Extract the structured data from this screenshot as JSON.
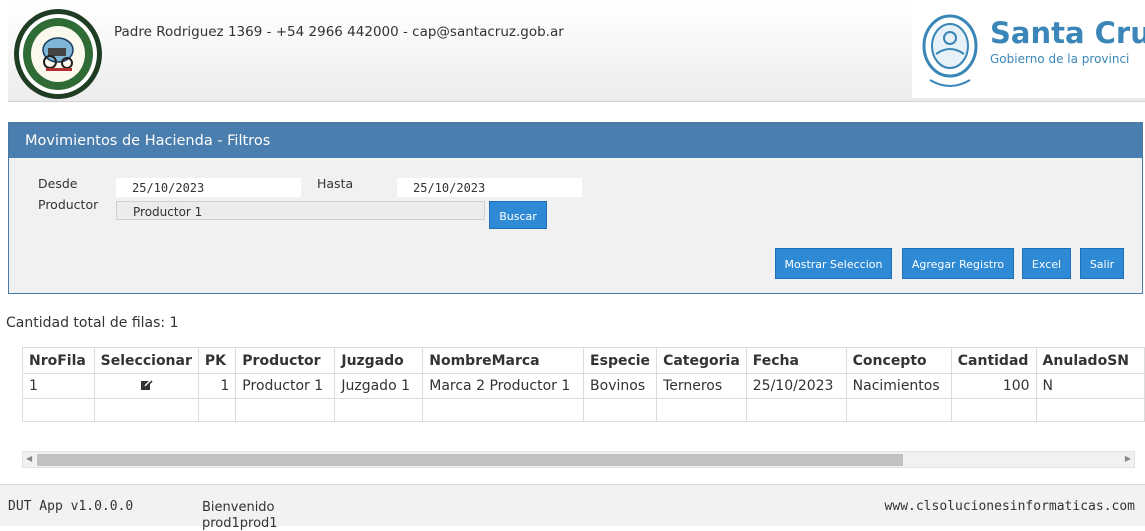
{
  "header": {
    "contact": "Padre Rodriguez 1369 - +54 2966 442000 - cap@santacruz.gob.ar",
    "seal_icon": "consejo-agrario-seal-icon",
    "province_name": "Santa Cruz",
    "province_subtitle": "Gobierno de la provinci"
  },
  "filters": {
    "title": "Movimientos de Hacienda - Filtros",
    "desde_label": "Desde",
    "desde_value": "25/10/2023",
    "hasta_label": "Hasta",
    "hasta_value": "25/10/2023",
    "productor_label": "Productor",
    "productor_value": "Productor 1",
    "buscar_label": "Buscar",
    "actions": [
      "Mostrar Seleccion",
      "Agregar Registro",
      "Excel",
      "Salir"
    ]
  },
  "summary": {
    "row_count_text": "Cantidad total de filas: 1"
  },
  "table": {
    "columns": [
      "NroFila",
      "Seleccionar",
      "PK",
      "Productor",
      "Juzgado",
      "NombreMarca",
      "Especie",
      "Categoria",
      "Fecha",
      "Concepto",
      "Cantidad",
      "AnuladoSN"
    ],
    "rows": [
      [
        "1",
        "",
        "1",
        "Productor 1",
        "Juzgado 1",
        "Marca 2 Productor 1",
        "Bovinos",
        "Terneros",
        "25/10/2023",
        "Nacimientos",
        "100",
        "N"
      ]
    ]
  },
  "footer": {
    "version": "DUT App v1.0.0.0",
    "welcome": "Bienvenido",
    "user": "prod1prod1",
    "website": "www.clsolucionesinformaticas.com"
  },
  "colors": {
    "panel_header": "#4a7eae",
    "button": "#2f8ad6",
    "province_blue": "#3a86b8"
  }
}
